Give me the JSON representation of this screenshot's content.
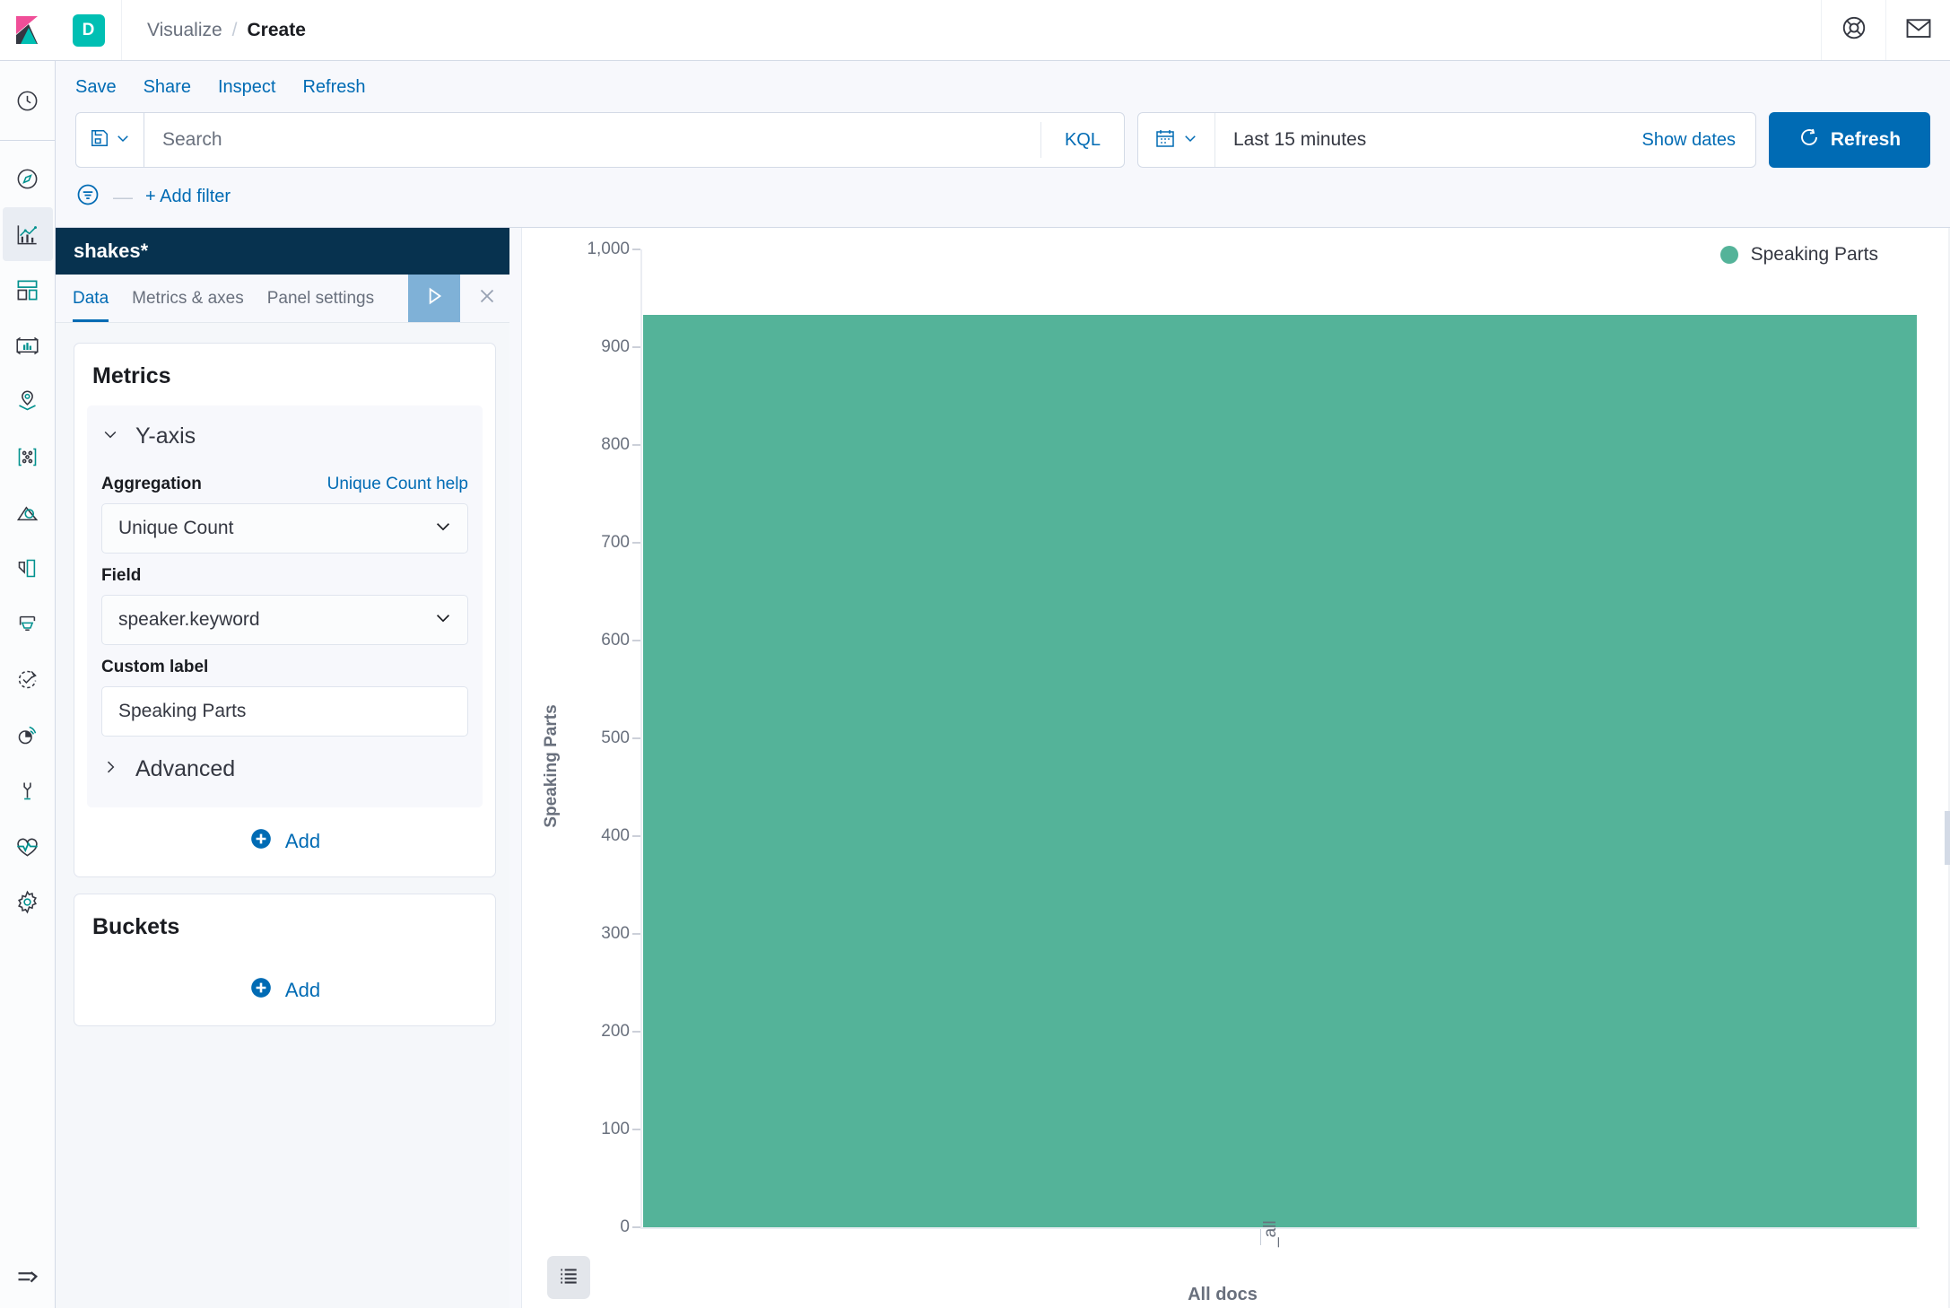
{
  "header": {
    "space_initial": "D",
    "breadcrumb": {
      "parent": "Visualize",
      "separator": "/",
      "current": "Create"
    },
    "help_icon": "life-ring-icon",
    "mail_icon": "envelope-icon"
  },
  "top_actions": [
    {
      "label": "Save",
      "name": "save"
    },
    {
      "label": "Share",
      "name": "share"
    },
    {
      "label": "Inspect",
      "name": "inspect"
    },
    {
      "label": "Refresh",
      "name": "refresh"
    }
  ],
  "query_bar": {
    "saved_query_icon": "save-disk-icon",
    "search_placeholder": "Search",
    "search_value": "",
    "language_badge": "KQL",
    "calendar_icon": "calendar-icon",
    "time_range": "Last 15 minutes",
    "show_dates_label": "Show dates",
    "refresh_button": "Refresh",
    "refresh_icon": "refresh-cycle-icon",
    "refresh_color": "#006bb4"
  },
  "filter_bar": {
    "filter_icon": "filter-funnel-icon",
    "dash": "—",
    "add_filter_label": "+ Add filter"
  },
  "sidebar": {
    "logo": "kibana-logo-icon",
    "items": [
      {
        "name": "recently-viewed",
        "icon": "clock-icon",
        "active": false
      },
      {
        "name": "discover",
        "icon": "compass-icon",
        "active": false
      },
      {
        "name": "visualize",
        "icon": "chart-bar-line-icon",
        "active": true
      },
      {
        "name": "dashboard",
        "icon": "dashboard-grid-icon",
        "active": false
      },
      {
        "name": "canvas",
        "icon": "canvas-frame-icon",
        "active": false
      },
      {
        "name": "maps",
        "icon": "map-pin-layers-icon",
        "active": false
      },
      {
        "name": "machine-learning",
        "icon": "ml-nodes-icon",
        "active": false
      },
      {
        "name": "infrastructure",
        "icon": "infrastructure-icon",
        "active": false
      },
      {
        "name": "logs",
        "icon": "logs-icon",
        "active": false
      },
      {
        "name": "apm",
        "icon": "apm-icon",
        "active": false
      },
      {
        "name": "uptime",
        "icon": "uptime-check-icon",
        "active": false
      },
      {
        "name": "siem",
        "icon": "siem-signal-icon",
        "active": false
      },
      {
        "name": "dev-tools",
        "icon": "wrench-icon",
        "active": false
      },
      {
        "name": "monitoring",
        "icon": "heart-pulse-icon",
        "active": false
      },
      {
        "name": "management",
        "icon": "gear-icon",
        "active": false
      }
    ],
    "collapse_icon": "collapse-arrow-icon"
  },
  "editor": {
    "index_pattern_title": "shakes*",
    "tabs": [
      {
        "label": "Data",
        "name": "data",
        "active": true
      },
      {
        "label": "Metrics & axes",
        "name": "metrics-axes",
        "active": false
      },
      {
        "label": "Panel settings",
        "name": "panel-settings",
        "active": false
      }
    ],
    "apply_icon": "play-triangle-icon",
    "close_icon": "close-x-icon",
    "metrics": {
      "card_title": "Metrics",
      "group_label": "Y-axis",
      "group_chevron": "chevron-down-icon",
      "aggregation_label": "Aggregation",
      "aggregation_help": "Unique Count help",
      "aggregation_value": "Unique Count",
      "field_label": "Field",
      "field_value": "speaker.keyword",
      "custom_label_label": "Custom label",
      "custom_label_value": "Speaking Parts",
      "advanced_label": "Advanced",
      "advanced_chevron": "chevron-right-icon",
      "add_label": "Add",
      "add_icon": "plus-circle-icon"
    },
    "buckets": {
      "card_title": "Buckets",
      "add_label": "Add",
      "add_icon": "plus-circle-icon"
    },
    "collapse_panel_icon": "chevron-left-circle-icon"
  },
  "chart_data": {
    "type": "bar",
    "title": "",
    "categories": [
      "_all"
    ],
    "values": [
      933
    ],
    "series": [
      {
        "name": "Speaking Parts",
        "values": [
          933
        ],
        "color": "#54b399"
      }
    ],
    "xlabel": "All docs",
    "ylabel": "Speaking Parts",
    "ylim": [
      0,
      1000
    ],
    "ytick_labels": [
      "0",
      "100",
      "200",
      "300",
      "400",
      "500",
      "600",
      "700",
      "800",
      "900",
      "1,000"
    ],
    "ytick_values": [
      0,
      100,
      200,
      300,
      400,
      500,
      600,
      700,
      800,
      900,
      1000
    ],
    "xtick_labels": [
      "_all"
    ],
    "grid": false,
    "legend": {
      "position": "top-right",
      "entries": [
        {
          "label": "Speaking Parts",
          "color": "#54b399"
        }
      ]
    },
    "legend_toggle_icon": "list-icon"
  }
}
